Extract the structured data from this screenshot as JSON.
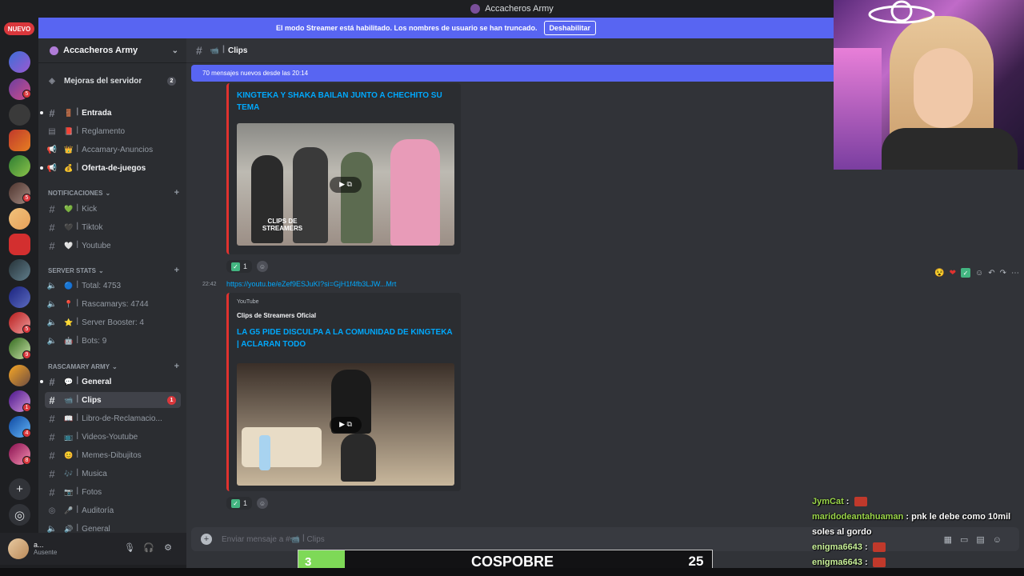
{
  "window": {
    "title": "Accacheros Army"
  },
  "rail": {
    "new_badge": "NUEVO",
    "badges": [
      "5",
      "5",
      "5",
      "9",
      "11",
      "1",
      "4",
      "8"
    ]
  },
  "banner": {
    "text": "El modo Streamer está habilitado. Los nombres de usuario se han truncado.",
    "button": "Deshabilitar"
  },
  "server": {
    "name": "Accacheros Army"
  },
  "sidebar": {
    "boost": {
      "label": "Mejoras del servidor",
      "count": "2"
    },
    "channels_top": [
      {
        "label": "Entrada",
        "emoji": "🚪"
      },
      {
        "label": "Reglamento",
        "emoji": "📕"
      },
      {
        "label": "Accamary-Anuncios",
        "emoji": "👑"
      },
      {
        "label": "Oferta-de-juegos",
        "emoji": "💰"
      }
    ],
    "cat_notif": "NOTIFICACIONES",
    "channels_notif": [
      {
        "label": "Kick",
        "emoji": "💚"
      },
      {
        "label": "Tiktok",
        "emoji": "🖤"
      },
      {
        "label": "Youtube",
        "emoji": "🤍"
      }
    ],
    "cat_stats": "SERVER STATS",
    "channels_stats": [
      {
        "label": "Total: 4753",
        "emoji": "🔵"
      },
      {
        "label": "Rascamarys: 4744",
        "emoji": "📍"
      },
      {
        "label": "Server Booster: 4",
        "emoji": "⭐"
      },
      {
        "label": "Bots: 9",
        "emoji": "🤖"
      }
    ],
    "cat_army": "RASCAMARY ARMY",
    "channels_army": [
      {
        "label": "General",
        "emoji": "💬"
      },
      {
        "label": "Clips",
        "emoji": "📹",
        "badge": "1"
      },
      {
        "label": "Libro-de-Reclamacio...",
        "emoji": "📖"
      },
      {
        "label": "Videos-Youtube",
        "emoji": "📺"
      },
      {
        "label": "Memes-Dibujitos",
        "emoji": "😊"
      },
      {
        "label": "Musica",
        "emoji": "🎶"
      },
      {
        "label": "Fotos",
        "emoji": "📷"
      },
      {
        "label": "Auditoría",
        "emoji": "🎤"
      },
      {
        "label": "General",
        "emoji": "🔊"
      }
    ]
  },
  "user": {
    "name": "a...",
    "status": "Ausente"
  },
  "channel": {
    "name": "Clips",
    "new_messages": "70 mensajes nuevos desde las 20:14"
  },
  "messages": {
    "embed1": {
      "title": "KINGTEKA Y SHAKA BAILAN JUNTO A CHECHITO SU TEMA",
      "thumb_text": "CLIPS DE STREAMERS",
      "reaction_count": "1"
    },
    "msg2": {
      "time": "22:42",
      "link": "https://youtu.be/eZef9ESJuKI?si=GjH1f4fb3LJW...Mrt"
    },
    "embed2": {
      "provider": "YouTube",
      "author": "Clips de Streamers Oficial",
      "title": "LA G5 PIDE DISCULPA A LA COMUNIDAD DE KINGTEKA | ACLARAN TODO",
      "reaction_count": "1"
    }
  },
  "composer": {
    "placeholder": "Enviar mensaje a #📹 ꟾ Clips"
  },
  "overlay": {
    "score_left": "3",
    "score_name": "COSPOBRE",
    "score_right": "25",
    "chat": [
      {
        "user": "JymCat",
        "text": ""
      },
      {
        "user": "maridodeantahuaman",
        "text": "pnk le debe como 10mil soles al gordo"
      },
      {
        "user": "enigma6643",
        "text": ""
      },
      {
        "user": "enigma6643",
        "text": ""
      }
    ]
  },
  "colors": {
    "accent": "#5865f2",
    "link": "#00a8fc",
    "danger": "#da373c",
    "embed_border": "#e0322f"
  }
}
